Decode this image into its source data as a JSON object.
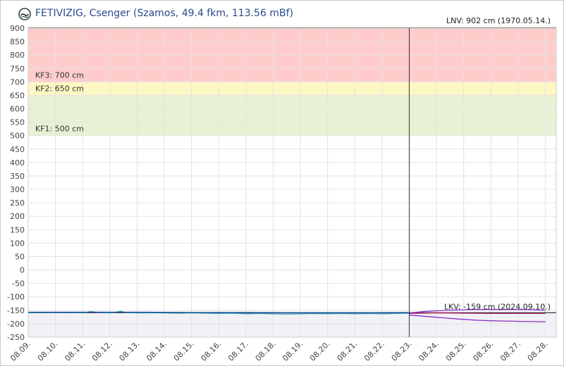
{
  "header": {
    "title": "FETIVIZIG, Csenger (Szamos, 49.4 fkm, 113.56 mBf)",
    "logo_icon": "hydro-wave-icon"
  },
  "chart_data": {
    "type": "line",
    "ylim": [
      -250,
      900
    ],
    "yticks": [
      900,
      850,
      800,
      750,
      700,
      650,
      600,
      550,
      500,
      450,
      400,
      350,
      300,
      250,
      200,
      150,
      100,
      50,
      0,
      -50,
      -100,
      -150,
      -200,
      -250
    ],
    "ytick_labels": [
      "900",
      "850",
      "800",
      "750",
      "700",
      "650",
      "600",
      "550",
      "500",
      "450",
      "400",
      "350",
      "300",
      "250",
      "200",
      "150",
      "100",
      "50",
      "0",
      "-50",
      "-100",
      "-150",
      "-200",
      "-250"
    ],
    "xrange": [
      0,
      19.4
    ],
    "xticks": [
      0,
      1,
      2,
      3,
      4,
      5,
      6,
      7,
      8,
      9,
      10,
      11,
      12,
      13,
      14,
      15,
      16,
      17,
      18,
      19
    ],
    "xtick_labels": [
      "08.09.",
      "08.10.",
      "08.11.",
      "08.12.",
      "08.13.",
      "08.14.",
      "08.15.",
      "08.16.",
      "08.17.",
      "08.18.",
      "08.19.",
      "08.20.",
      "08.21.",
      "08.22.",
      "08.23.",
      "08.24.",
      "08.25.",
      "08.26.",
      "08.27.",
      "08.28."
    ],
    "grid": true,
    "zones": [
      {
        "from": 700,
        "to": 900,
        "color": "#ffcccc"
      },
      {
        "from": 650,
        "to": 700,
        "color": "#fdf7c3"
      },
      {
        "from": 500,
        "to": 650,
        "color": "#e6f2d3"
      },
      {
        "from": -250,
        "to": -159,
        "color": "#f2f2f6"
      }
    ],
    "thresholds": [
      {
        "label": "KF3: 700 cm",
        "value": 700
      },
      {
        "label": "KF2: 650 cm",
        "value": 650
      },
      {
        "label": "KF1: 500 cm",
        "value": 500
      }
    ],
    "annotations": [
      {
        "label": "LNV: 902 cm (1970.05.14.)",
        "value": 902,
        "line_color": "#888888"
      },
      {
        "label": "LKV: -159 cm (2024.09.10.)",
        "value": -159,
        "line_color": "#333333"
      }
    ],
    "now_x": 14.0,
    "series": [
      {
        "color": "#2a9aa6",
        "x": [
          0,
          0.5,
          1,
          1.5,
          2,
          2.3,
          2.6,
          3,
          3.4,
          3.6,
          4,
          4.5,
          5,
          5.5,
          6,
          6.5,
          7,
          7.5,
          8,
          8.5,
          9,
          9.5,
          10,
          10.5,
          11,
          11.5,
          12,
          12.5,
          13,
          13.5,
          14
        ],
        "values": [
          -159,
          -158,
          -159,
          -158,
          -160,
          -155,
          -158,
          -160,
          -154,
          -158,
          -160,
          -159,
          -160,
          -161,
          -160,
          -161,
          -162,
          -161,
          -163,
          -162,
          -163,
          -164,
          -163,
          -162,
          -163,
          -162,
          -163,
          -162,
          -163,
          -162,
          -161
        ]
      },
      {
        "color": "#1f4ea3",
        "x": [
          0,
          2,
          4,
          6,
          8,
          10,
          12,
          14
        ],
        "values": [
          -157,
          -157,
          -157,
          -158,
          -158,
          -159,
          -159,
          -158
        ]
      },
      {
        "color": "#b0206a",
        "x": [
          14,
          15,
          16,
          17,
          18,
          19
        ],
        "values": [
          -162,
          -160,
          -161,
          -162,
          -162,
          -162
        ]
      },
      {
        "color": "#8a2fc7",
        "x": [
          14,
          14.5,
          15,
          15.5,
          16,
          16.5,
          17,
          17.5,
          18,
          18.5,
          19
        ],
        "values": [
          -160,
          -155,
          -152,
          -150,
          -148,
          -147,
          -147,
          -147,
          -147,
          -148,
          -150
        ]
      },
      {
        "color": "#8a2fc7",
        "x": [
          14,
          14.5,
          15,
          15.5,
          16,
          16.5,
          17,
          17.5,
          18,
          18.5,
          19
        ],
        "values": [
          -168,
          -172,
          -176,
          -180,
          -184,
          -187,
          -189,
          -190,
          -191,
          -192,
          -193
        ]
      }
    ]
  }
}
